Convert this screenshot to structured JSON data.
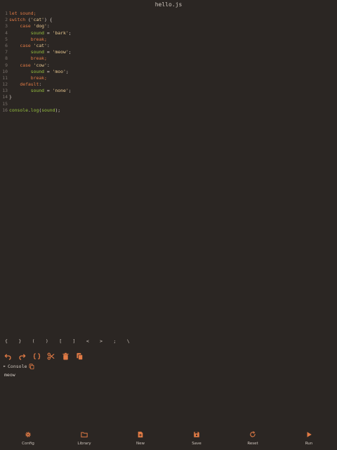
{
  "title": "hello.js",
  "colors": {
    "accent": "#e07a45",
    "keyword": "#e07a45",
    "property": "#97c23e",
    "string": "#e9c891",
    "background": "#2b2623"
  },
  "code_lines": [
    [
      {
        "t": "let sound;",
        "c": "kw"
      }
    ],
    [
      {
        "t": "switch ",
        "c": "kw"
      },
      {
        "t": "(",
        "c": "punc"
      },
      {
        "t": "'cat'",
        "c": "str"
      },
      {
        "t": ") {",
        "c": "punc"
      }
    ],
    [
      {
        "t": "    case ",
        "c": "kw"
      },
      {
        "t": "'dog'",
        "c": "str"
      },
      {
        "t": ":",
        "c": "punc"
      }
    ],
    [
      {
        "t": "        sound",
        "c": "prop"
      },
      {
        "t": " = ",
        "c": "punc"
      },
      {
        "t": "'bark'",
        "c": "str"
      },
      {
        "t": ";",
        "c": "punc"
      }
    ],
    [
      {
        "t": "        break;",
        "c": "kw"
      }
    ],
    [
      {
        "t": "    case ",
        "c": "kw"
      },
      {
        "t": "'cat'",
        "c": "str"
      },
      {
        "t": ":",
        "c": "punc"
      }
    ],
    [
      {
        "t": "        sound",
        "c": "prop"
      },
      {
        "t": " = ",
        "c": "punc"
      },
      {
        "t": "'meow'",
        "c": "str"
      },
      {
        "t": ";",
        "c": "punc"
      }
    ],
    [
      {
        "t": "        break;",
        "c": "kw"
      }
    ],
    [
      {
        "t": "    case ",
        "c": "kw"
      },
      {
        "t": "'cow'",
        "c": "str"
      },
      {
        "t": ":",
        "c": "punc"
      }
    ],
    [
      {
        "t": "        sound",
        "c": "prop"
      },
      {
        "t": " = ",
        "c": "punc"
      },
      {
        "t": "'moo'",
        "c": "str"
      },
      {
        "t": ";",
        "c": "punc"
      }
    ],
    [
      {
        "t": "        break;",
        "c": "kw"
      }
    ],
    [
      {
        "t": "    default",
        "c": "kw"
      },
      {
        "t": ":",
        "c": "punc"
      }
    ],
    [
      {
        "t": "        sound",
        "c": "prop"
      },
      {
        "t": " = ",
        "c": "punc"
      },
      {
        "t": "'none'",
        "c": "str"
      },
      {
        "t": ";",
        "c": "punc"
      }
    ],
    [
      {
        "t": "}",
        "c": "punc"
      }
    ],
    [],
    [
      {
        "t": "console",
        "c": "fn"
      },
      {
        "t": ".",
        "c": "punc"
      },
      {
        "t": "log",
        "c": "fn"
      },
      {
        "t": "(",
        "c": "punc"
      },
      {
        "t": "sound",
        "c": "prop"
      },
      {
        "t": ");",
        "c": "punc"
      }
    ]
  ],
  "symbols": [
    "{",
    "}",
    "(",
    ")",
    "[",
    "]",
    "<",
    ">",
    ";",
    "\\"
  ],
  "toolbar_icons": [
    "undo-icon",
    "redo-icon",
    "braces-icon",
    "scissors-icon",
    "trash-icon",
    "copy-icon"
  ],
  "console": {
    "label": "Console",
    "output": "meow"
  },
  "bottom_nav": [
    {
      "label": "Config",
      "icon": "gear-icon"
    },
    {
      "label": "Library",
      "icon": "folder-icon"
    },
    {
      "label": "New",
      "icon": "new-file-icon"
    },
    {
      "label": "Save",
      "icon": "save-icon"
    },
    {
      "label": "Reset",
      "icon": "reset-icon"
    },
    {
      "label": "Run",
      "icon": "play-icon"
    }
  ]
}
